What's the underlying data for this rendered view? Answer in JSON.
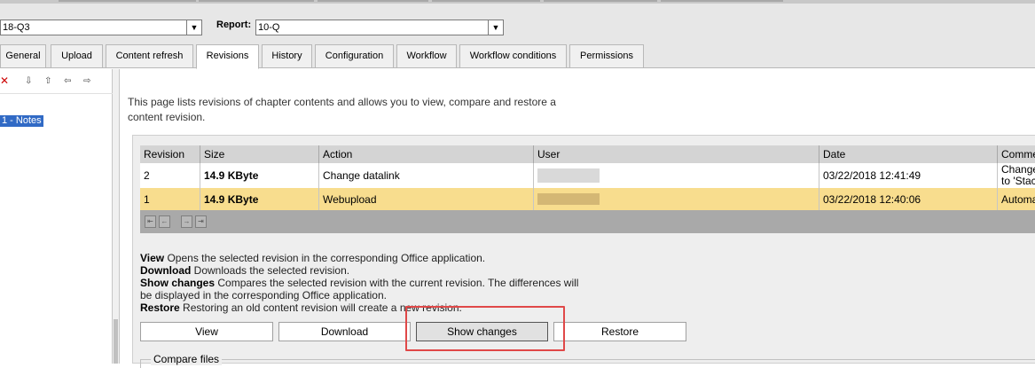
{
  "top": {
    "fiscal_select_value": "18-Q3",
    "report_label": "Report:",
    "report_select_value": "10-Q"
  },
  "tabs": [
    "General",
    "Upload",
    "Content refresh",
    "Revisions",
    "History",
    "Configuration",
    "Workflow",
    "Workflow conditions",
    "Permissions"
  ],
  "active_tab": "Revisions",
  "tree": {
    "selected_node": "1 - Notes"
  },
  "intro_text": "This page lists revisions of chapter contents and allows you to view, compare and restore a content revision.",
  "table": {
    "columns": [
      "Revision",
      "Size",
      "Action",
      "User",
      "Date",
      "Comme"
    ],
    "rows": [
      {
        "revision": "2",
        "size": "14.9 KByte",
        "action": "Change datalink",
        "date": "03/22/2018 12:41:49",
        "comment_line1": "Change",
        "comment_line2": "to 'Stac",
        "selected": false
      },
      {
        "revision": "1",
        "size": "14.9 KByte",
        "action": "Webupload",
        "date": "03/22/2018 12:40:06",
        "comment_line1": "Automa",
        "selected": true
      }
    ]
  },
  "help": {
    "view_term": "View",
    "view_desc": " Opens the selected revision in the corresponding Office application.",
    "download_term": "Download",
    "download_desc": " Downloads the selected revision.",
    "show_changes_term": "Show changes",
    "show_changes_desc": " Compares the selected revision with the current revision. The differences will be displayed in the corresponding Office application.",
    "restore_term": "Restore",
    "restore_desc": " Restoring an old content revision will create a new revision."
  },
  "buttons": {
    "view": "View",
    "download": "Download",
    "show_changes": "Show changes",
    "restore": "Restore"
  },
  "compare_files_legend": "Compare files",
  "colors": {
    "selected_row": "#f8dd8e",
    "tree_selection": "#316ac5",
    "annotation_box": "#e04848"
  }
}
